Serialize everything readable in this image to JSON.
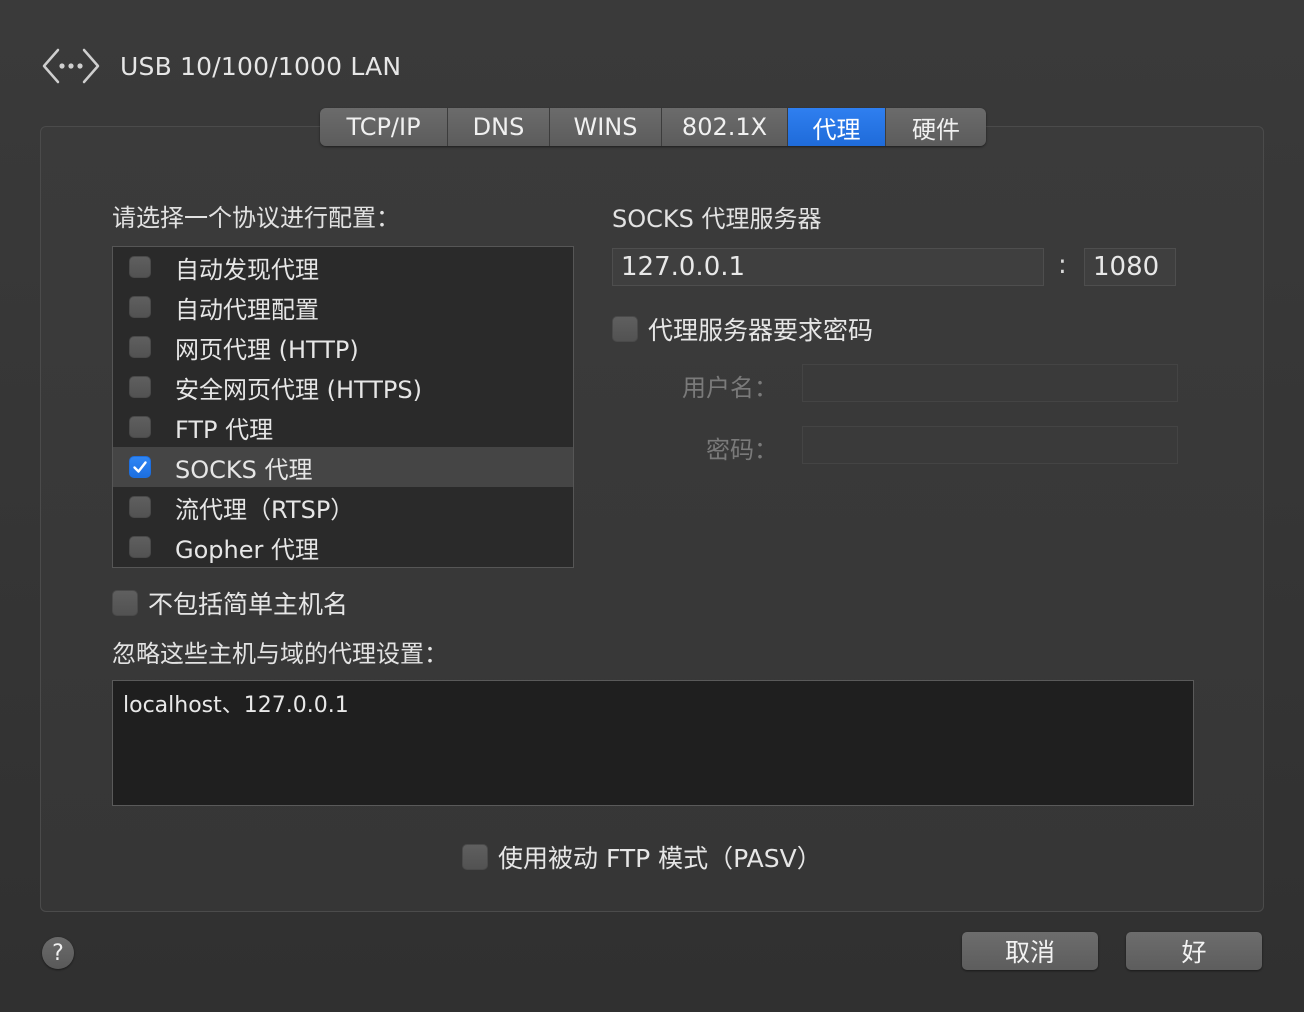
{
  "header": {
    "icon": "ethernet-arrows-icon",
    "title": "USB 10/100/1000 LAN"
  },
  "tabs": [
    {
      "label": "TCP/IP",
      "active": false
    },
    {
      "label": "DNS",
      "active": false
    },
    {
      "label": "WINS",
      "active": false
    },
    {
      "label": "802.1X",
      "active": false
    },
    {
      "label": "代理",
      "active": true
    },
    {
      "label": "硬件",
      "active": false
    }
  ],
  "protocols": {
    "heading": "请选择一个协议进行配置：",
    "items": [
      {
        "label": "自动发现代理",
        "checked": false,
        "selected": false
      },
      {
        "label": "自动代理配置",
        "checked": false,
        "selected": false
      },
      {
        "label": "网页代理 (HTTP)",
        "checked": false,
        "selected": false
      },
      {
        "label": "安全网页代理 (HTTPS)",
        "checked": false,
        "selected": false
      },
      {
        "label": "FTP 代理",
        "checked": false,
        "selected": false
      },
      {
        "label": "SOCKS 代理",
        "checked": true,
        "selected": true
      },
      {
        "label": "流代理（RTSP）",
        "checked": false,
        "selected": false
      },
      {
        "label": "Gopher 代理",
        "checked": false,
        "selected": false
      }
    ]
  },
  "server": {
    "heading": "SOCKS 代理服务器",
    "host": "127.0.0.1",
    "separator": ":",
    "port": "1080",
    "require_password_label": "代理服务器要求密码",
    "require_password_checked": false,
    "username_label": "用户名：",
    "username_value": "",
    "password_label": "密码：",
    "password_value": ""
  },
  "exclude_simple_hostnames": {
    "label": "不包括简单主机名",
    "checked": false
  },
  "bypass": {
    "heading": "忽略这些主机与域的代理设置：",
    "value": "localhost、127.0.0.1"
  },
  "passive_ftp": {
    "label": "使用被动 FTP 模式（PASV）",
    "checked": false
  },
  "footer": {
    "help": "?",
    "cancel": "取消",
    "ok": "好"
  },
  "colors": {
    "accent": "#1f6bd9",
    "background": "#353535"
  }
}
